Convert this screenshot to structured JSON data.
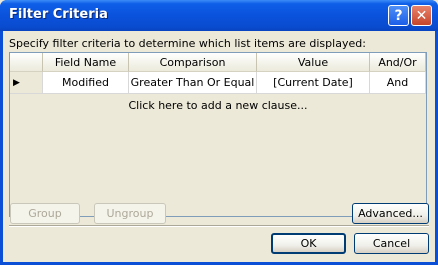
{
  "window": {
    "title": "Filter Criteria",
    "help_glyph": "?",
    "close_glyph": "✕"
  },
  "description": "Specify filter criteria to determine which list items are displayed:",
  "grid": {
    "columns": [
      "",
      "Field Name",
      "Comparison",
      "Value",
      "And/Or"
    ],
    "rows": [
      {
        "marker": "▶",
        "field": "Modified",
        "comparison": "Greater Than Or Equal",
        "value": "[Current Date]",
        "andor": "And"
      }
    ],
    "add_clause": "Click here to add a new clause..."
  },
  "buttons": {
    "group": "Group",
    "ungroup": "Ungroup",
    "advanced": "Advanced...",
    "ok": "OK",
    "cancel": "Cancel"
  }
}
